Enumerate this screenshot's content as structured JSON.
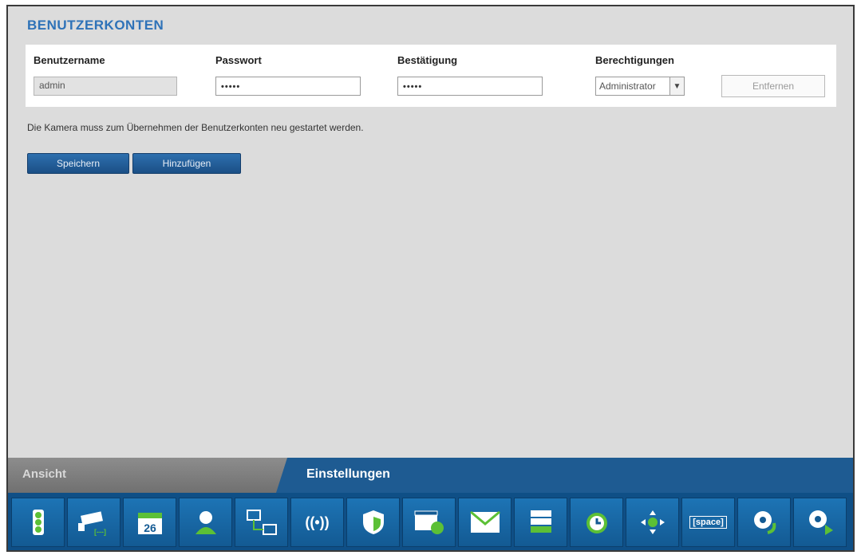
{
  "section_title": "BENUTZERKONTEN",
  "columns": {
    "username": "Benutzername",
    "password": "Passwort",
    "confirm": "Bestätigung",
    "permissions": "Berechtigungen"
  },
  "account": {
    "username": "admin",
    "password": "•••••",
    "confirm": "•••••",
    "permission": "Administrator"
  },
  "remove_label": "Entfernen",
  "notice": "Die Kamera muss zum Übernehmen der Benutzerkonten neu gestartet werden.",
  "buttons": {
    "save": "Speichern",
    "add": "Hinzufügen"
  },
  "tabs": {
    "view": "Ansicht",
    "settings": "Einstellungen"
  },
  "icons": {
    "calendar_day": "26",
    "wireless": "((•))",
    "space": "[space]"
  },
  "colors": {
    "accent": "#2e72b8",
    "bar": "#1e5b92",
    "green": "#5cc036"
  }
}
